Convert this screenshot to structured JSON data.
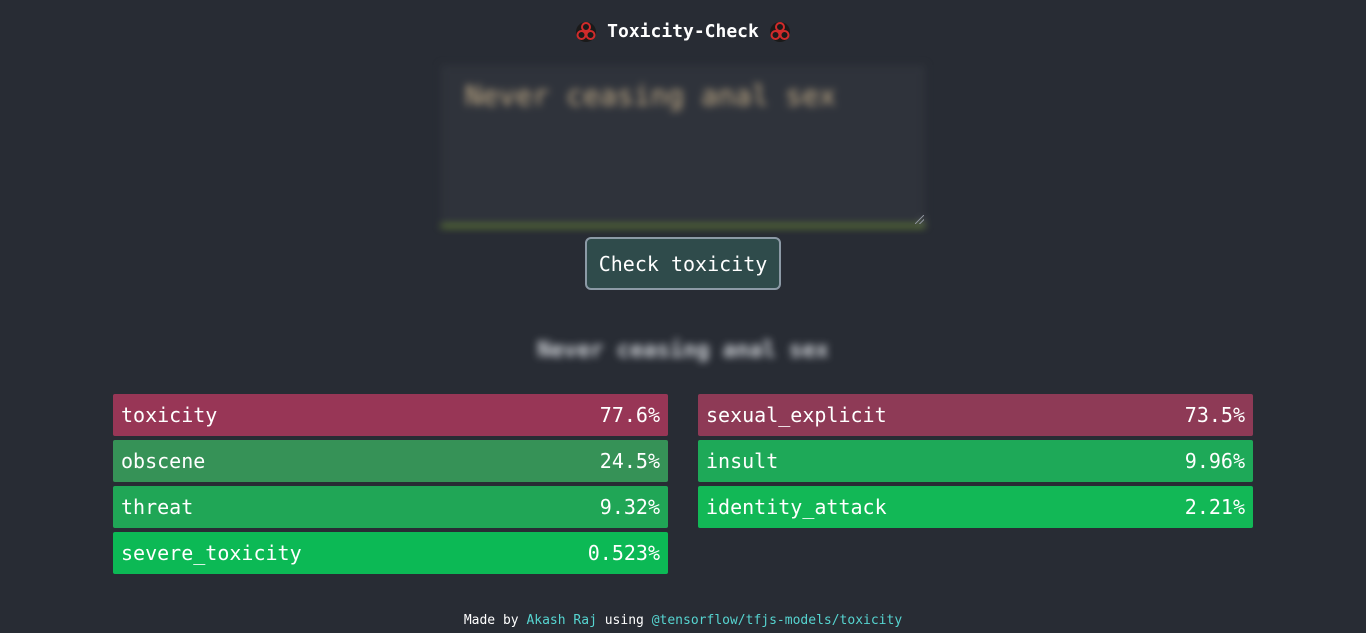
{
  "header": {
    "title": "Toxicity-Check",
    "icon": "biohazard-icon"
  },
  "input": {
    "value": "Never ceasing anal sex"
  },
  "check_button": {
    "label": "Check toxicity"
  },
  "echo_text": "Never ceasing anal sex",
  "results": {
    "left": [
      {
        "label": "toxicity",
        "value": "77.6%",
        "color": "#983656"
      },
      {
        "label": "obscene",
        "value": "24.5%",
        "color": "#369257"
      },
      {
        "label": "threat",
        "value": "9.32%",
        "color": "#20a656"
      },
      {
        "label": "severe_toxicity",
        "value": "0.523%",
        "color": "#0cb955"
      }
    ],
    "right": [
      {
        "label": "sexual_explicit",
        "value": "73.5%",
        "color": "#8e3a56"
      },
      {
        "label": "insult",
        "value": "9.96%",
        "color": "#1ea958"
      },
      {
        "label": "identity_attack",
        "value": "2.21%",
        "color": "#12b856"
      }
    ]
  },
  "footer": {
    "made_by": "Made by",
    "author": "Akash Raj",
    "using": "using",
    "library": "@tensorflow/tfjs-models/toxicity",
    "link_color": "#56d4d0"
  }
}
